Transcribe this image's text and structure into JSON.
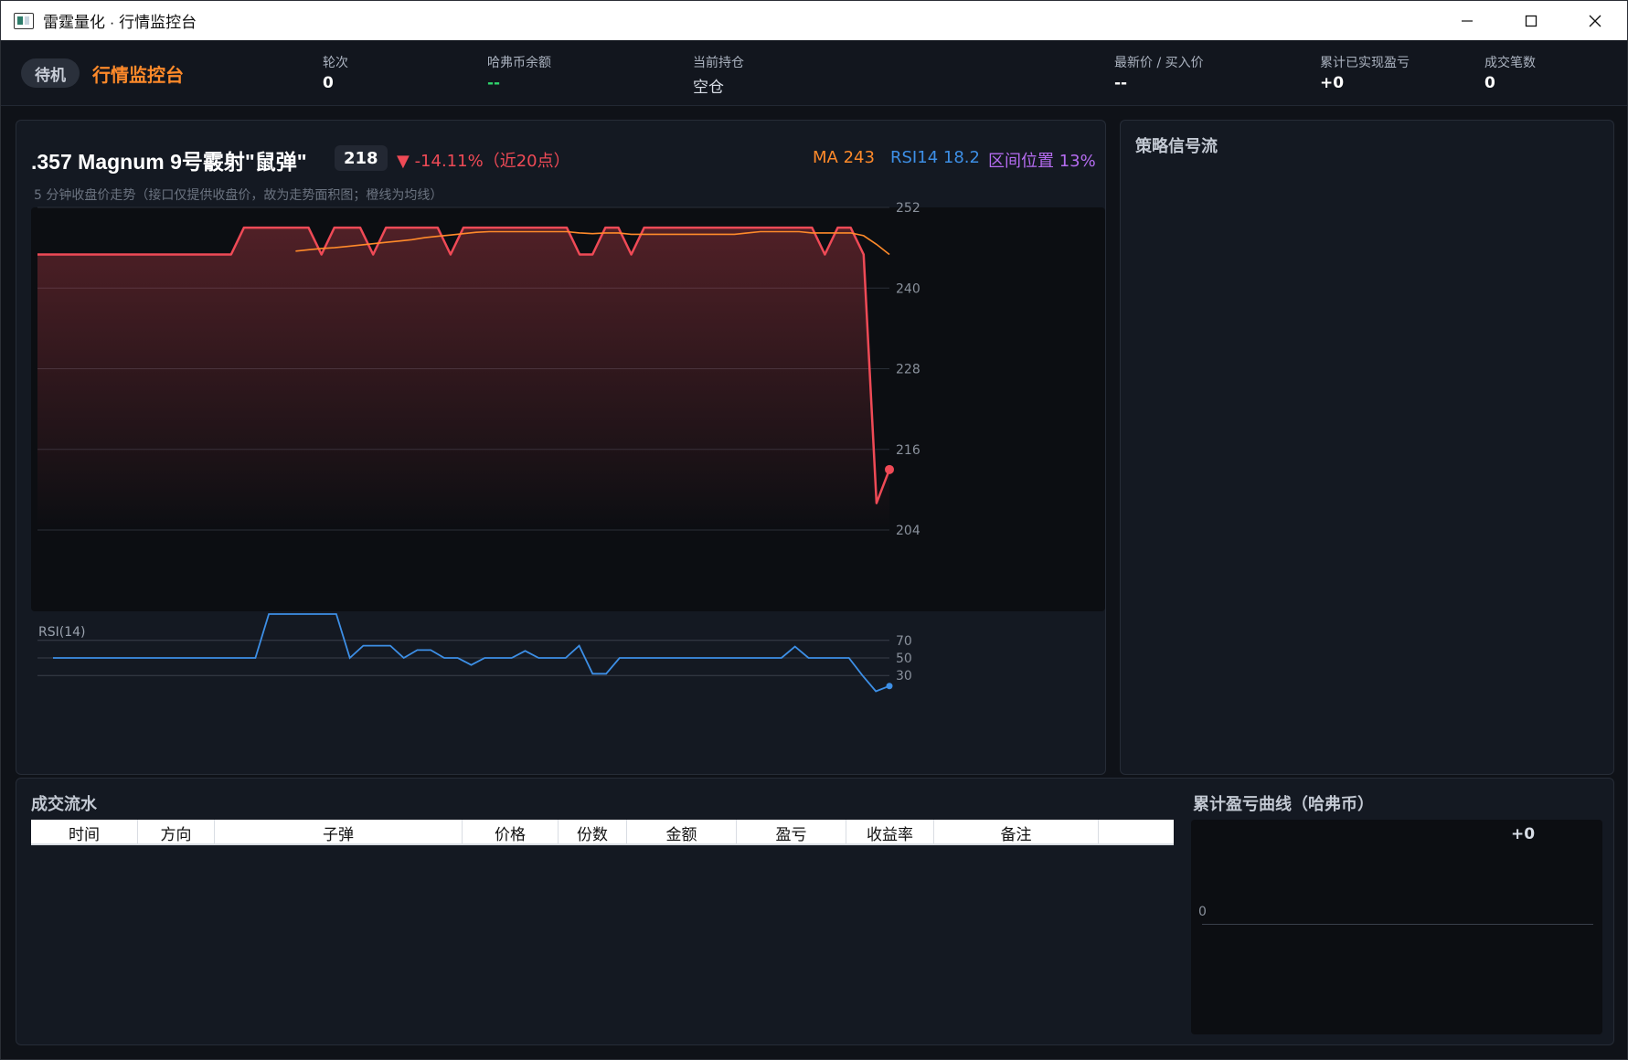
{
  "window": {
    "title": "雷霆量化 · 行情监控台"
  },
  "header": {
    "status": "待机",
    "app_title": "行情监控台",
    "stats": {
      "round_label": "轮次",
      "round_value": "0",
      "balance_label": "哈弗币余额",
      "balance_value": "--",
      "position_label": "当前持仓",
      "position_value": "空仓",
      "price_label": "最新价 / 买入价",
      "price_value": "--",
      "pnl_label": "累计已实现盈亏",
      "pnl_value": "+0",
      "trades_label": "成交笔数",
      "trades_value": "0"
    }
  },
  "chart_panel": {
    "instrument": ".357 Magnum 9号霰射\"鼠弹\"",
    "price": "218",
    "change": "▼ -14.11%（近20点）",
    "ma": "MA 243",
    "rsi": "RSI14 18.2",
    "range_position": "区间位置 13%",
    "subtitle": "5 分钟收盘价走势（接口仅提供收盘价，故为走势面积图；橙线为均线）",
    "rsi_label": "RSI(14)",
    "colors": {
      "price_line": "#ef4a56",
      "ma_line": "#ff8a2a",
      "rsi_line": "#3d8fe6",
      "range": "#b56cf0"
    }
  },
  "chart_data": [
    {
      "type": "area",
      "y_ticks": [
        252,
        240,
        228,
        216,
        204
      ],
      "ylim": [
        204,
        252
      ],
      "grid": true,
      "series": [
        {
          "values": [
            245,
            245,
            245,
            245,
            245,
            245,
            245,
            245,
            245,
            245,
            245,
            245,
            245,
            245,
            245,
            245,
            249,
            249,
            249,
            249,
            249,
            249,
            245,
            249,
            249,
            249,
            245,
            249,
            249,
            249,
            249,
            249,
            245,
            249,
            249,
            249,
            249,
            249,
            249,
            249,
            249,
            249,
            245,
            245,
            249,
            249,
            245,
            249,
            249,
            249,
            249,
            249,
            249,
            249,
            249,
            249,
            249,
            249,
            249,
            249,
            249,
            245,
            249,
            249,
            245,
            208,
            213
          ]
        },
        {
          "values": [
            null,
            null,
            null,
            null,
            null,
            null,
            null,
            null,
            null,
            null,
            null,
            null,
            null,
            null,
            null,
            null,
            null,
            null,
            null,
            null,
            245.5,
            245.7,
            245.9,
            246.0,
            246.2,
            246.4,
            246.6,
            246.8,
            247.0,
            247.2,
            247.5,
            247.7,
            247.9,
            248.1,
            248.3,
            248.4,
            248.4,
            248.4,
            248.4,
            248.4,
            248.4,
            248.4,
            248.2,
            248.1,
            248.2,
            248.2,
            248.0,
            248.0,
            248.0,
            248.0,
            248.0,
            248.0,
            248.0,
            248.0,
            248.0,
            248.2,
            248.4,
            248.4,
            248.4,
            248.4,
            248.2,
            248.2,
            248.2,
            248.2,
            247.8,
            246.5,
            245.0
          ]
        }
      ]
    },
    {
      "type": "line",
      "y_ticks": [
        70,
        50,
        30
      ],
      "ylim": [
        0,
        100
      ],
      "series": [
        {
          "values": [
            50,
            50,
            50,
            50,
            50,
            50,
            50,
            50,
            50,
            50,
            50,
            50,
            50,
            50,
            50,
            50,
            100,
            100,
            100,
            100,
            100,
            100,
            50,
            64,
            64,
            64,
            50,
            59,
            59,
            50,
            50,
            42,
            50,
            50,
            50,
            58,
            50,
            50,
            50,
            64,
            32,
            32,
            50,
            50,
            50,
            50,
            50,
            50,
            50,
            50,
            50,
            50,
            50,
            50,
            50,
            63,
            50,
            50,
            50,
            50,
            30,
            12,
            18
          ]
        }
      ]
    }
  ],
  "signal_panel": {
    "title": "策略信号流"
  },
  "trade_panel": {
    "title": "成交流水",
    "columns": [
      "时间",
      "方向",
      "子弹",
      "价格",
      "份数",
      "金额",
      "盈亏",
      "收益率",
      "备注",
      ""
    ],
    "pnl_title": "累计盈亏曲线（哈弗币）",
    "pnl_value": "+0",
    "pnl_zero": "0"
  }
}
